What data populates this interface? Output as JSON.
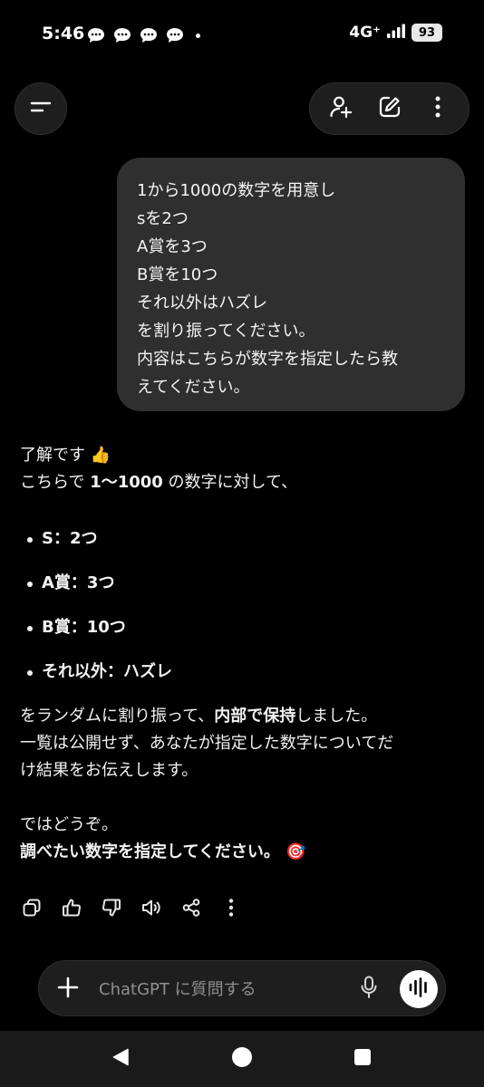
{
  "status_bar": {
    "time": "5:46",
    "network": "4G⁺",
    "battery": "93",
    "icons": [
      "chat-bubble-icon",
      "chat-bubble-icon",
      "chat-bubble-icon",
      "chat-bubble-icon",
      "dot-icon",
      "signal-icon",
      "battery-icon"
    ]
  },
  "header": {
    "icons": [
      "menu-icon",
      "add-person-icon",
      "new-chat-icon",
      "more-vertical-icon"
    ]
  },
  "user_message": {
    "lines": [
      "1から1000の数字を用意し",
      "sを2つ",
      "A賞を3つ",
      "B賞を10つ",
      "それ以外はハズレ",
      "を割り振ってください。",
      "内容はこちらが数字を指定したら教",
      "えてください。"
    ]
  },
  "assistant_message": {
    "intro_1": "了解です 👍",
    "intro_2_pre": "こちらで ",
    "intro_2_bold": "1〜1000",
    "intro_2_post": " の数字に対して、",
    "bullets": [
      "S：2つ",
      "A賞：3つ",
      "B賞：10つ",
      "それ以外：ハズレ"
    ],
    "para_1_pre": "をランダムに割り振って、",
    "para_1_bold1": "内部で保持",
    "para_1_mid": "し",
    "para_1_post": "ました。",
    "para_2": "一覧は公開せず、あなたが指定した数字についてだ",
    "para_3": "け結果をお伝えします。",
    "closing_1": "ではどうぞ。",
    "closing_2": "調べたい数字を指定してください。 🎯"
  },
  "actions": {
    "icons": [
      "copy-icon",
      "thumbs-up-icon",
      "thumbs-down-icon",
      "read-aloud-icon",
      "share-icon",
      "more-vertical-icon"
    ]
  },
  "composer": {
    "placeholder": "ChatGPT に質問する",
    "value": ""
  },
  "nav": {
    "icons": [
      "back-icon",
      "home-icon",
      "recents-icon"
    ]
  },
  "colors": {
    "background": "#000000",
    "bubble": "#2f2f2f",
    "surface": "#1e1e1e",
    "text": "#f2f2f2",
    "placeholder": "#8f8f8f"
  }
}
